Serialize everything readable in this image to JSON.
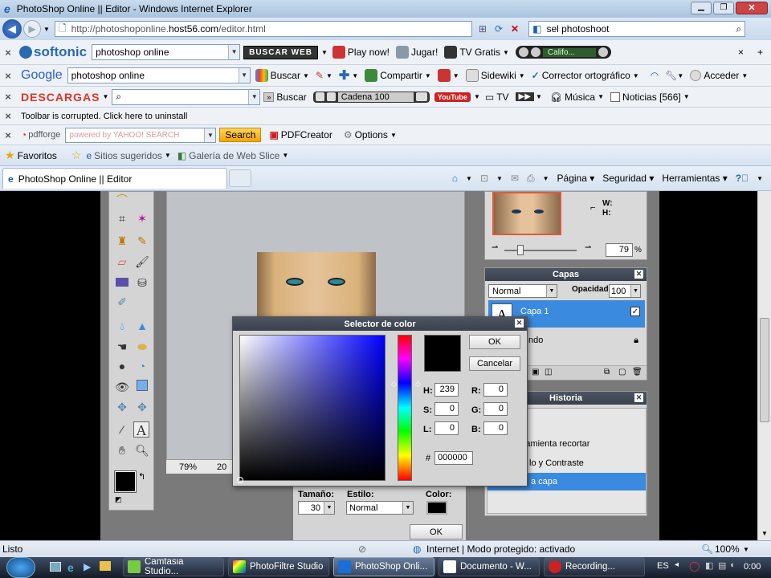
{
  "window": {
    "title": "PhotoShop Online || Editor - Windows Internet Explorer"
  },
  "address": {
    "url_prefix": "http://photoshoponline.",
    "url_domain": "host56.com",
    "url_path": "/editor.html",
    "search_value": "sel photoshoot"
  },
  "softonic": {
    "brand": "softonic",
    "search_value": "photoshop online",
    "buscar": "BUSCAR WEB",
    "play": "Play now!",
    "jugar": "Jugar!",
    "tv": "TV Gratis",
    "radio": "Califo..."
  },
  "google": {
    "brand": "Google",
    "search_value": "photoshop online",
    "buscar": "Buscar",
    "compartir": "Compartir",
    "sidewiki": "Sidewiki",
    "corrector": "Corrector ortográfico",
    "acceder": "Acceder"
  },
  "descargas": {
    "brand": "DESCARGAS",
    "buscar": "Buscar",
    "cadena": "Cadena 100",
    "youtube": "YouTube",
    "tv": "TV",
    "musica": "Música",
    "noticias": "Noticias [566]"
  },
  "notice": {
    "text": "Toolbar is corrupted. Click here to uninstall"
  },
  "pdfforge": {
    "brand": "pdfforge",
    "placeholder": "powered by YAHOO! SEARCH",
    "search": "Search",
    "creator": "PDFCreator",
    "options": "Options"
  },
  "favbar": {
    "favoritos": "Favoritos",
    "sitios": "Sitios sugeridos",
    "galeria": "Galería de Web Slice"
  },
  "tab": {
    "title": "PhotoShop Online || Editor",
    "pagina": "Página",
    "seguridad": "Seguridad",
    "herramientas": "Herramientas"
  },
  "editor": {
    "zoom_label": "79%",
    "zoom_label_partial": "20"
  },
  "navigator": {
    "w_label": "W:",
    "h_label": "H:",
    "zoom_value": "79",
    "zoom_unit": "%"
  },
  "layers": {
    "title": "Capas",
    "blend_mode": "Normal",
    "opacity_label": "Opacidad:",
    "opacity_value": "100",
    "items": [
      {
        "name": "Capa 1"
      },
      {
        "name": "ndo"
      }
    ]
  },
  "history": {
    "title": "Historia",
    "items": [
      {
        "label": "rramienta recortar"
      },
      {
        "label": "lo y Contraste"
      },
      {
        "label": "a capa"
      }
    ]
  },
  "text_options": {
    "size_label": "Tamaño:",
    "size_value": "30",
    "style_label": "Estilo:",
    "style_value": "Normal",
    "color_label": "Color:",
    "ok": "OK"
  },
  "color_picker": {
    "title": "Selector de color",
    "ok": "OK",
    "cancel": "Cancelar",
    "h_label": "H:",
    "h_value": "239",
    "s_label": "S:",
    "s_value": "0",
    "l_label": "L:",
    "l_value": "0",
    "r_label": "R:",
    "r_value": "0",
    "g_label": "G:",
    "g_value": "0",
    "b_label": "B:",
    "b_value": "0",
    "hash_label": "#",
    "hex_value": "000000",
    "base_hue_color": "#0000ff",
    "current_color": "#000000"
  },
  "status": {
    "text": "Listo",
    "zone": "Internet | Modo protegido: activado",
    "zoom": "100%"
  },
  "taskbar": {
    "items": [
      "Camtasia Studio...",
      "PhotoFiltre Studio",
      "PhotoShop Onli...",
      "Documento - W...",
      "Recording..."
    ],
    "lang": "ES",
    "time": "0:00"
  }
}
